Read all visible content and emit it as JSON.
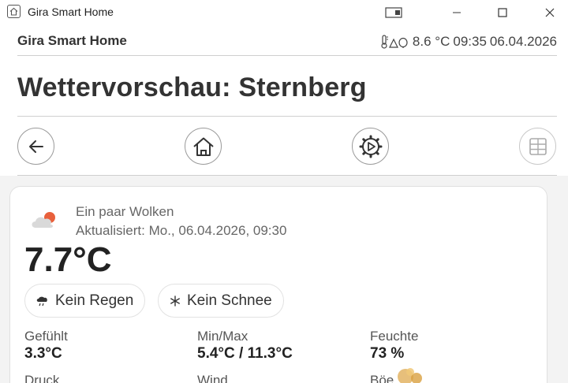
{
  "window": {
    "title": "Gira Smart Home"
  },
  "header": {
    "brand": "Gira Smart Home",
    "outdoor_temp": "8.6 °C",
    "time": "09:35",
    "date": "06.04.2026"
  },
  "page": {
    "title": "Wettervorschau: Sternberg"
  },
  "icons": {
    "app": "home-outline-icon",
    "outdoor": "thermometer-trees-icon",
    "back": "arrow-left-icon",
    "home": "home-icon",
    "scene": "gear-play-icon",
    "grid": "grid-icon",
    "weather": "partly-cloudy-icon",
    "rain": "cloud-rain-icon",
    "snow": "snowflake-icon"
  },
  "weather": {
    "condition": "Ein paar Wolken",
    "updated": "Aktualisiert: Mo., 06.04.2026, 09:30",
    "temperature": "7.7°C",
    "rain_chip": "Kein Regen",
    "snow_chip": "Kein Schnee",
    "metrics": [
      {
        "label": "Gefühlt",
        "value": "3.3°C"
      },
      {
        "label": "Min/Max",
        "value": "5.4°C / 11.3°C"
      },
      {
        "label": "Feuchte",
        "value": "73 %"
      },
      {
        "label": "Druck",
        "value": ""
      },
      {
        "label": "Wind",
        "value": ""
      },
      {
        "label": "Böe",
        "value": ""
      }
    ]
  },
  "colors": {
    "accent": "#e8603c",
    "text": "#2b2b2b",
    "muted": "#666666"
  }
}
